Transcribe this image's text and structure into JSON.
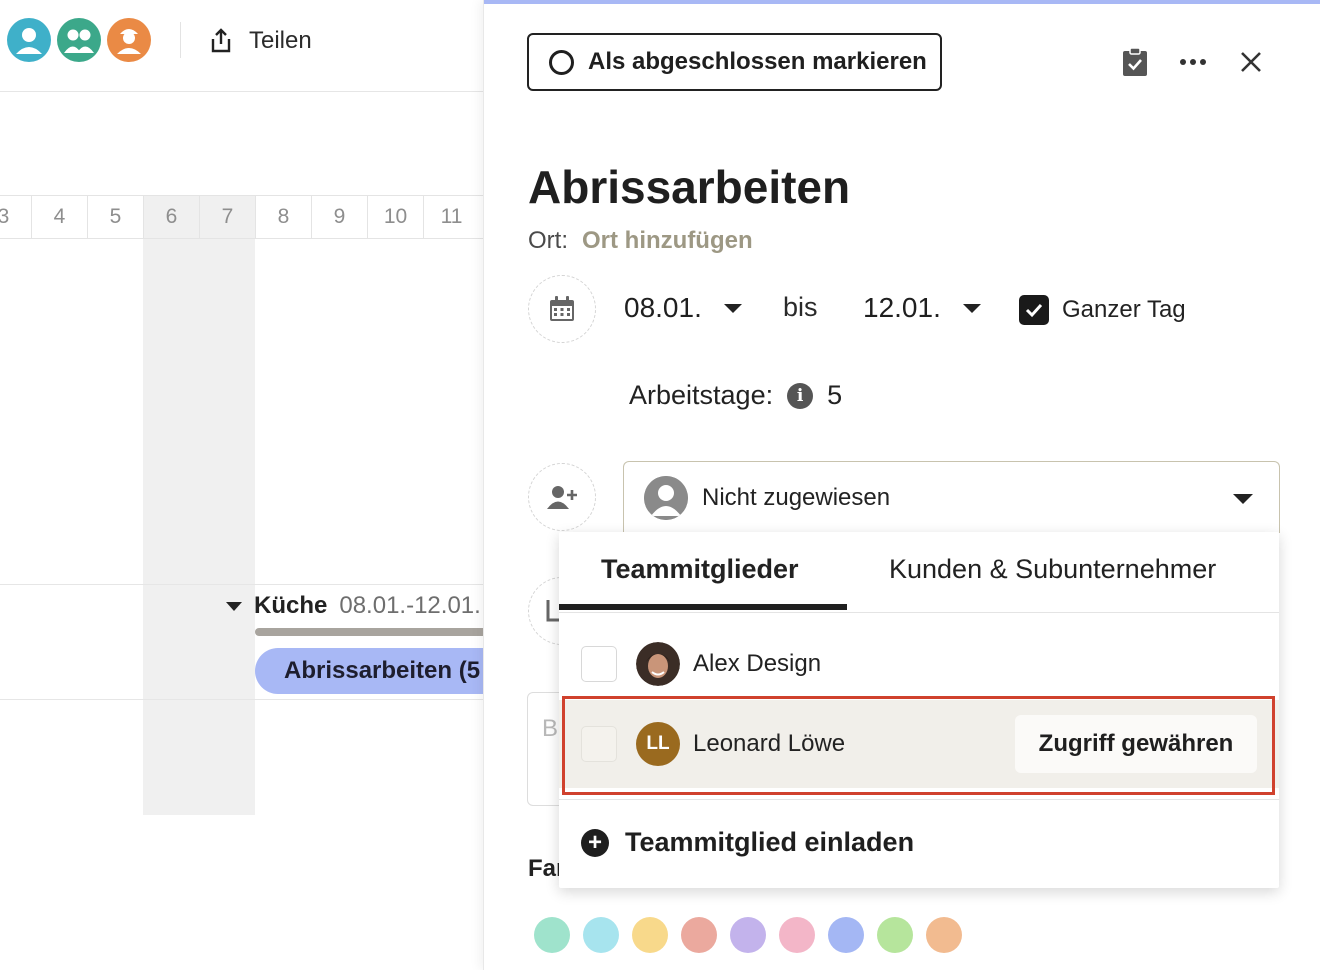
{
  "topbar": {
    "share_label": "Teilen",
    "avatars": [
      {
        "name": "user-avatar-1",
        "color": "#3fb0c9"
      },
      {
        "name": "team-avatar",
        "color": "#3ca88a"
      },
      {
        "name": "worker-avatar",
        "color": "#ea8a45"
      }
    ]
  },
  "gantt": {
    "days": [
      "3",
      "4",
      "5",
      "6",
      "7",
      "8",
      "9",
      "10",
      "11"
    ],
    "group": {
      "name": "Küche",
      "dates": "08.01.-12.01."
    },
    "task_bar_label": "Abrissarbeiten (5"
  },
  "panel": {
    "complete_label": "Als abgeschlossen markieren",
    "title": "Abrissarbeiten",
    "location_label": "Ort:",
    "location_placeholder": "Ort hinzufügen",
    "start_date": "08.01.",
    "until_label": "bis",
    "end_date": "12.01.",
    "allday_label": "Ganzer Tag",
    "workdays_label": "Arbeitstage:",
    "workdays_value": "5",
    "assignee": "Nicht zugewiesen",
    "description_placeholder": "Be",
    "color_label": "Far",
    "swatches": [
      "#9fe3cc",
      "#a7e4ee",
      "#f8d98b",
      "#eba99e",
      "#c3b3ec",
      "#f3b6c8",
      "#a4b7f4",
      "#b6e59c",
      "#f2bb90"
    ]
  },
  "dropdown": {
    "tabs": [
      "Teammitglieder",
      "Kunden & Subunternehmer"
    ],
    "members": [
      {
        "name": "Alex Design",
        "initials": ""
      },
      {
        "name": "Leonard Löwe",
        "initials": "LL",
        "action": "Zugriff gewähren"
      }
    ],
    "invite_label": "Teammitglied einladen"
  }
}
